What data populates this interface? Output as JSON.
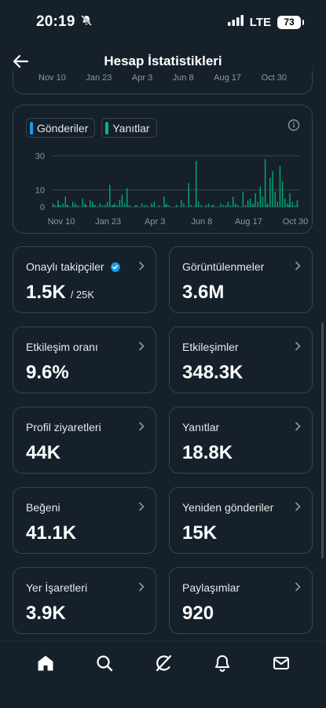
{
  "status_bar": {
    "time": "20:19",
    "network": "LTE",
    "battery": "73",
    "icons": [
      "bell-slash-icon",
      "signal-icon",
      "battery-icon"
    ]
  },
  "header": {
    "title": "Hesap İstatistikleri",
    "back_icon": "arrow-left-icon"
  },
  "previous_chart": {
    "x_labels": [
      "Nov 10",
      "Jan 23",
      "Apr 3",
      "Jun 8",
      "Aug 17",
      "Oct 30"
    ]
  },
  "chart": {
    "legend": [
      {
        "label": "Gönderiler",
        "color": "#1d9bf0"
      },
      {
        "label": "Yanıtlar",
        "color": "#00ba7c"
      }
    ],
    "info_icon": "info-icon"
  },
  "chart_data": {
    "type": "bar",
    "x_tick_labels": [
      "Nov 10",
      "Jan 23",
      "Apr 3",
      "Jun 8",
      "Aug 17",
      "Oct 30"
    ],
    "y_ticks": [
      0,
      10,
      30
    ],
    "ylim": [
      0,
      30
    ],
    "grid": true,
    "series": [
      {
        "name": "Gönderiler",
        "color": "#1d9bf0",
        "values": [
          1,
          0,
          1,
          0,
          0,
          1,
          0,
          0,
          1,
          0,
          0,
          0,
          1,
          0,
          0,
          1,
          0,
          0,
          0,
          1,
          0,
          0,
          1,
          0,
          0,
          0,
          0,
          1,
          0,
          0,
          1,
          0,
          0,
          0,
          0,
          0,
          1,
          0,
          0,
          0,
          0,
          1,
          0,
          0,
          0,
          1,
          0,
          0,
          0,
          0,
          0,
          0,
          1,
          0,
          0,
          0,
          0,
          0,
          1,
          0,
          0,
          0,
          0,
          1,
          0,
          0,
          0,
          0,
          0,
          0,
          0,
          0,
          0,
          1,
          0,
          0,
          0,
          0,
          1,
          0,
          0,
          0,
          0,
          0,
          0,
          0,
          1,
          0,
          0,
          1
        ]
      },
      {
        "name": "Yanıtlar",
        "color": "#00ba7c",
        "values": [
          2,
          1,
          4,
          1,
          2,
          6,
          1,
          0,
          3,
          2,
          1,
          0,
          5,
          2,
          0,
          4,
          3,
          1,
          0,
          2,
          1,
          0,
          3,
          13,
          1,
          2,
          1,
          4,
          7,
          2,
          11,
          1,
          0,
          0,
          1,
          0,
          2,
          1,
          1,
          0,
          2,
          3,
          0,
          1,
          0,
          6,
          2,
          1,
          0,
          0,
          1,
          0,
          4,
          2,
          0,
          14,
          1,
          0,
          27,
          3,
          1,
          0,
          1,
          2,
          0,
          1,
          0,
          0,
          2,
          1,
          0,
          3,
          1,
          6,
          2,
          1,
          0,
          9,
          1,
          4,
          5,
          2,
          8,
          3,
          12,
          6,
          28,
          2,
          17,
          21,
          9,
          3,
          24,
          15,
          5,
          2,
          8,
          3,
          1,
          4
        ]
      }
    ]
  },
  "stats": [
    {
      "label": "Onaylı takipçiler",
      "value": "1.5K",
      "sub": "/ 25K",
      "verified": true
    },
    {
      "label": "Görüntülenmeler",
      "value": "3.6M"
    },
    {
      "label": "Etkileşim oranı",
      "value": "9.6%"
    },
    {
      "label": "Etkileşimler",
      "value": "348.3K"
    },
    {
      "label": "Profil ziyaretleri",
      "value": "44K"
    },
    {
      "label": "Yanıtlar",
      "value": "18.8K"
    },
    {
      "label": "Beğeni",
      "value": "41.1K"
    },
    {
      "label": "Yeniden gönderiler",
      "value": "15K"
    },
    {
      "label": "Yer İşaretleri",
      "value": "3.9K"
    },
    {
      "label": "Paylaşımlar",
      "value": "920"
    }
  ],
  "nav": [
    {
      "name": "home-icon",
      "active": true
    },
    {
      "name": "search-icon",
      "active": false
    },
    {
      "name": "grok-icon",
      "active": false
    },
    {
      "name": "notifications-bell-icon",
      "active": false
    },
    {
      "name": "messages-envelope-icon",
      "active": false
    }
  ]
}
